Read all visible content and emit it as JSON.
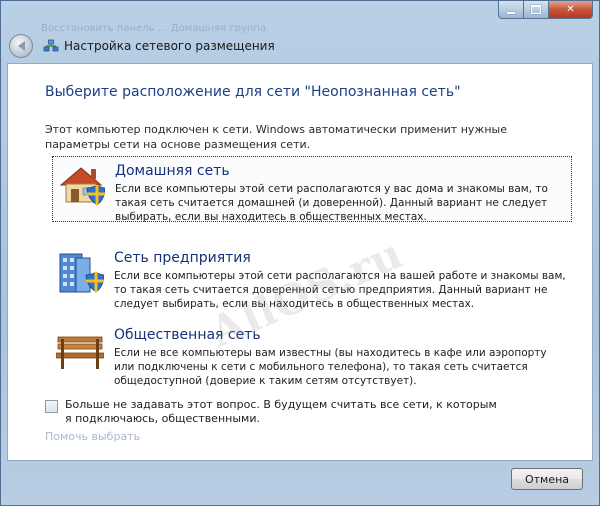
{
  "window": {
    "ghost_tabs": "Восстановить панель …    Домашняя группа"
  },
  "header": {
    "title": "Настройка сетевого размещения"
  },
  "page": {
    "title": "Выберите расположение для сети \"Неопознанная сеть\"",
    "intro": "Этот компьютер подключен к сети. Windows автоматически применит нужные параметры сети на основе размещения сети."
  },
  "options": [
    {
      "title": "Домашняя сеть",
      "desc": "Если все компьютеры этой сети располагаются у вас дома и знакомы вам, то такая сеть считается домашней (и доверенной). Данный вариант не следует выбирать, если вы находитесь в общественных местах.",
      "icon": "house-icon"
    },
    {
      "title": "Сеть предприятия",
      "desc": "Если все компьютеры этой сети располагаются на вашей работе и знакомы вам, то такая сеть считается доверенной сетью предприятия. Данный вариант не следует выбирать, если вы находитесь в общественных местах.",
      "icon": "office-building-icon"
    },
    {
      "title": "Общественная сеть",
      "desc": "Если не все компьютеры вам известны (вы находитесь в кафе или аэропорту или подключены к сети с мобильного телефона), то такая сеть считается общедоступной (доверие к таким сетям отсутствует).",
      "icon": "park-bench-icon"
    }
  ],
  "remember": {
    "label": "Больше не задавать этот вопрос. В будущем считать все сети, к которым я подключаюсь, общественными.",
    "checked": false
  },
  "help_link": "Помочь выбрать",
  "footer": {
    "cancel_label": "Отмена"
  },
  "watermark": "AllOS.ru",
  "colors": {
    "title_blue": "#1c3f88",
    "option_title_blue": "#17317a",
    "frame_blue": "#a9c3dd"
  }
}
